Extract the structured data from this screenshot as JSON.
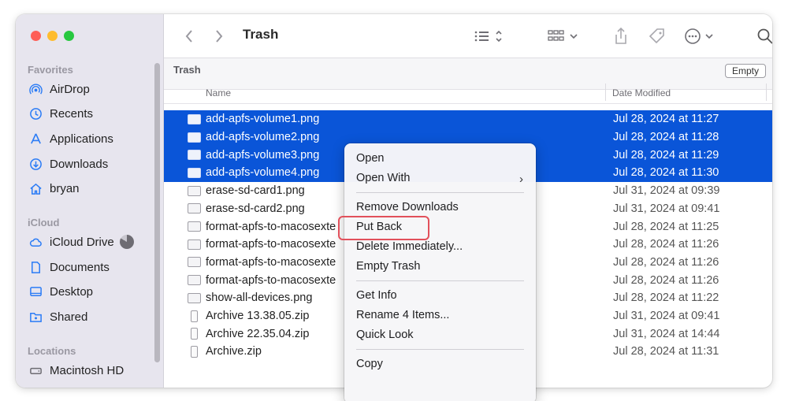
{
  "toolbar": {
    "title": "Trash"
  },
  "pathbar": {
    "location": "Trash",
    "empty_button": "Empty"
  },
  "columns": {
    "name": "Name",
    "date": "Date Modified"
  },
  "sidebar": {
    "favorites_label": "Favorites",
    "favorites": [
      {
        "label": "AirDrop",
        "icon": "airdrop-icon"
      },
      {
        "label": "Recents",
        "icon": "clock-icon"
      },
      {
        "label": "Applications",
        "icon": "applications-icon"
      },
      {
        "label": "Downloads",
        "icon": "download-icon"
      },
      {
        "label": "bryan",
        "icon": "home-icon"
      }
    ],
    "icloud_label": "iCloud",
    "icloud": [
      {
        "label": "iCloud Drive",
        "icon": "cloud-icon"
      },
      {
        "label": "Documents",
        "icon": "document-icon"
      },
      {
        "label": "Desktop",
        "icon": "desktop-icon"
      },
      {
        "label": "Shared",
        "icon": "shared-folder-icon"
      }
    ],
    "locations_label": "Locations",
    "locations": [
      {
        "label": "Macintosh HD",
        "icon": "disk-icon"
      }
    ]
  },
  "files": [
    {
      "name": "add-apfs-volume1.png",
      "date": "Jul 28, 2024 at 11:27",
      "selected": true,
      "kind": "image"
    },
    {
      "name": "add-apfs-volume2.png",
      "date": "Jul 28, 2024 at 11:28",
      "selected": true,
      "kind": "image"
    },
    {
      "name": "add-apfs-volume3.png",
      "date": "Jul 28, 2024 at 11:29",
      "selected": true,
      "kind": "image"
    },
    {
      "name": "add-apfs-volume4.png",
      "date": "Jul 28, 2024 at 11:30",
      "selected": true,
      "kind": "image"
    },
    {
      "name": "erase-sd-card1.png",
      "date": "Jul 31, 2024 at 09:39",
      "selected": false,
      "kind": "image"
    },
    {
      "name": "erase-sd-card2.png",
      "date": "Jul 31, 2024 at 09:41",
      "selected": false,
      "kind": "image"
    },
    {
      "name": "format-apfs-to-macosexte",
      "date": "Jul 28, 2024 at 11:25",
      "selected": false,
      "kind": "image"
    },
    {
      "name": "format-apfs-to-macosexte",
      "date": "Jul 28, 2024 at 11:26",
      "selected": false,
      "kind": "image"
    },
    {
      "name": "format-apfs-to-macosexte",
      "date": "Jul 28, 2024 at 11:26",
      "selected": false,
      "kind": "image"
    },
    {
      "name": "format-apfs-to-macosexte",
      "date": "Jul 28, 2024 at 11:26",
      "selected": false,
      "kind": "image"
    },
    {
      "name": "show-all-devices.png",
      "date": "Jul 28, 2024 at 11:22",
      "selected": false,
      "kind": "image"
    },
    {
      "name": "Archive 13.38.05.zip",
      "date": "Jul 31, 2024 at 09:41",
      "selected": false,
      "kind": "zip"
    },
    {
      "name": "Archive 22.35.04.zip",
      "date": "Jul 31, 2024 at 14:44",
      "selected": false,
      "kind": "zip"
    },
    {
      "name": "Archive.zip",
      "date": "Jul 28, 2024 at 11:31",
      "selected": false,
      "kind": "zip"
    }
  ],
  "context_menu": {
    "open": "Open",
    "open_with": "Open With",
    "remove_downloads": "Remove Downloads",
    "put_back": "Put Back",
    "delete_immediately": "Delete Immediately...",
    "empty_trash": "Empty Trash",
    "get_info": "Get Info",
    "rename": "Rename 4 Items...",
    "quick_look": "Quick Look",
    "copy": "Copy"
  },
  "colors": {
    "selection": "#0a55d8",
    "sidebar_bg": "#e7e5ee",
    "highlight_outline": "#e2505b"
  }
}
